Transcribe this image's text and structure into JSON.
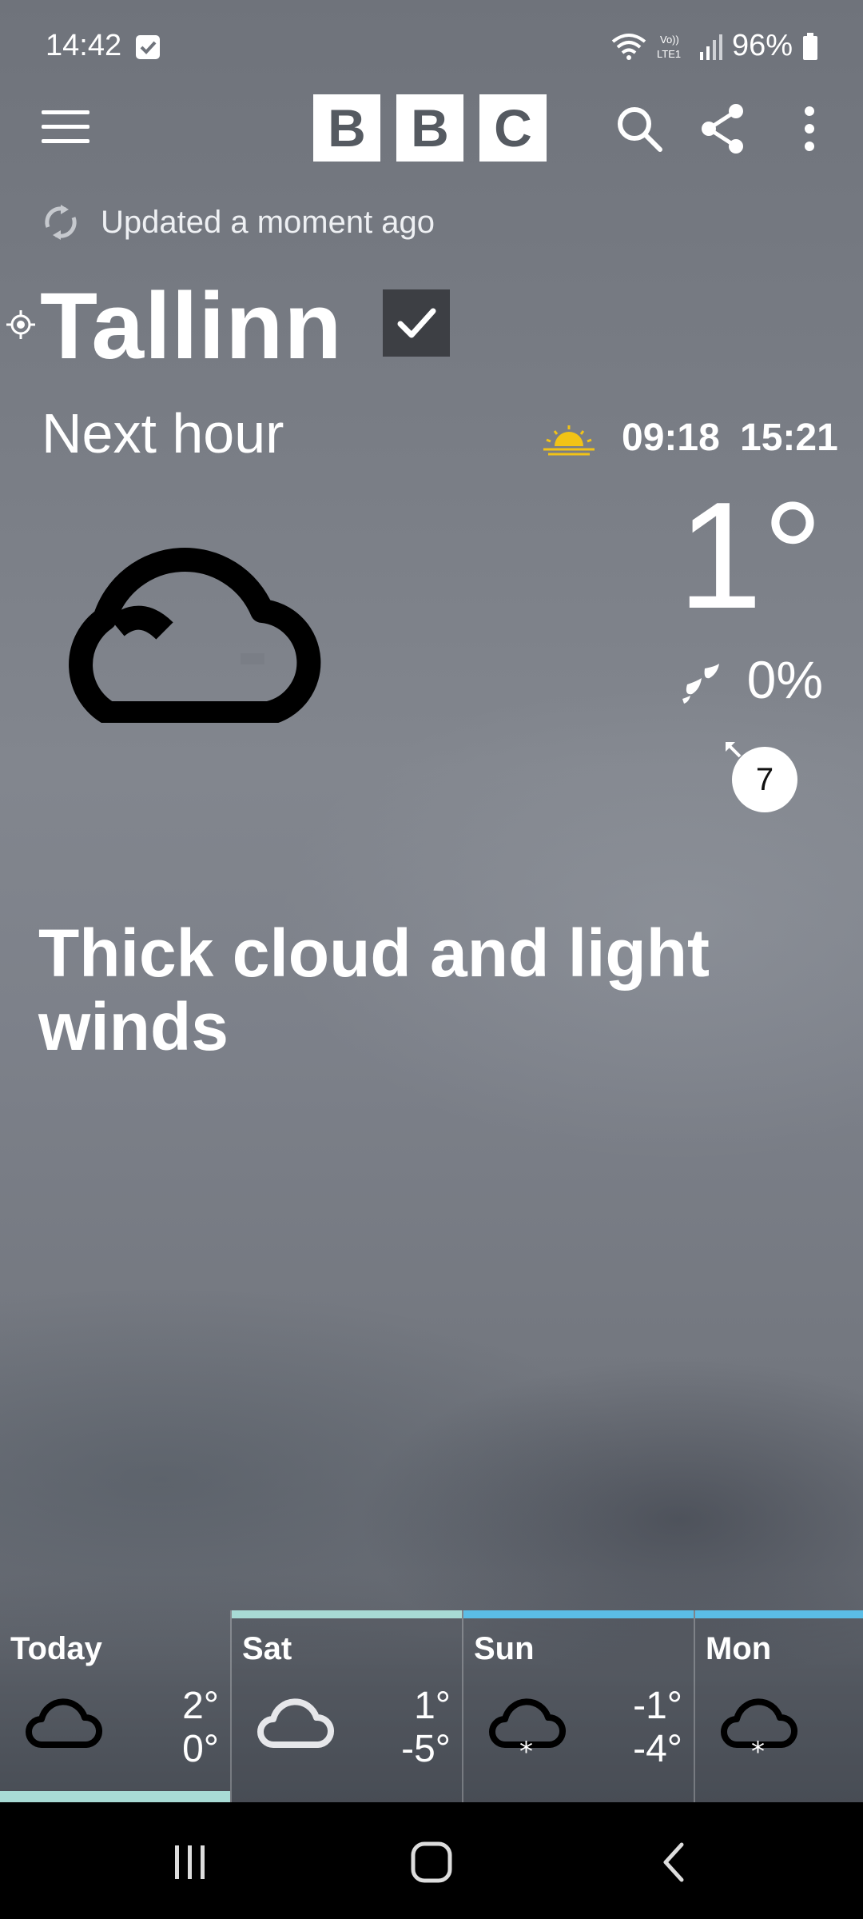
{
  "status_bar": {
    "time": "14:42",
    "battery": "96%",
    "icons": [
      "wifi-icon",
      "volte-icon",
      "signal-icon",
      "battery-icon"
    ]
  },
  "app_bar": {
    "logo_letters": [
      "B",
      "B",
      "C"
    ],
    "icons": [
      "menu-icon",
      "search-icon",
      "share-icon",
      "more-options-icon"
    ]
  },
  "update": {
    "text": "Updated a moment ago"
  },
  "location": {
    "city": "Tallinn"
  },
  "current": {
    "label": "Next hour",
    "sunrise": "09:18",
    "sunset": "15:21",
    "temperature": "1°",
    "precipitation": "0%",
    "wind_speed": "7",
    "summary": "Thick cloud and light winds"
  },
  "forecast": [
    {
      "day": "Today",
      "high": "2°",
      "low": "0°",
      "icon": "cloud-icon"
    },
    {
      "day": "Sat",
      "high": "1°",
      "low": "-5°",
      "icon": "cloud-icon"
    },
    {
      "day": "Sun",
      "high": "-1°",
      "low": "-4°",
      "icon": "snow-cloud-icon"
    },
    {
      "day": "Mon",
      "high": "",
      "low": "",
      "icon": "snow-cloud-icon"
    }
  ],
  "colors": {
    "today_accent": "#a8dbd5",
    "cold_accent": "#5bbde6",
    "sun_icon": "#f2c316"
  }
}
